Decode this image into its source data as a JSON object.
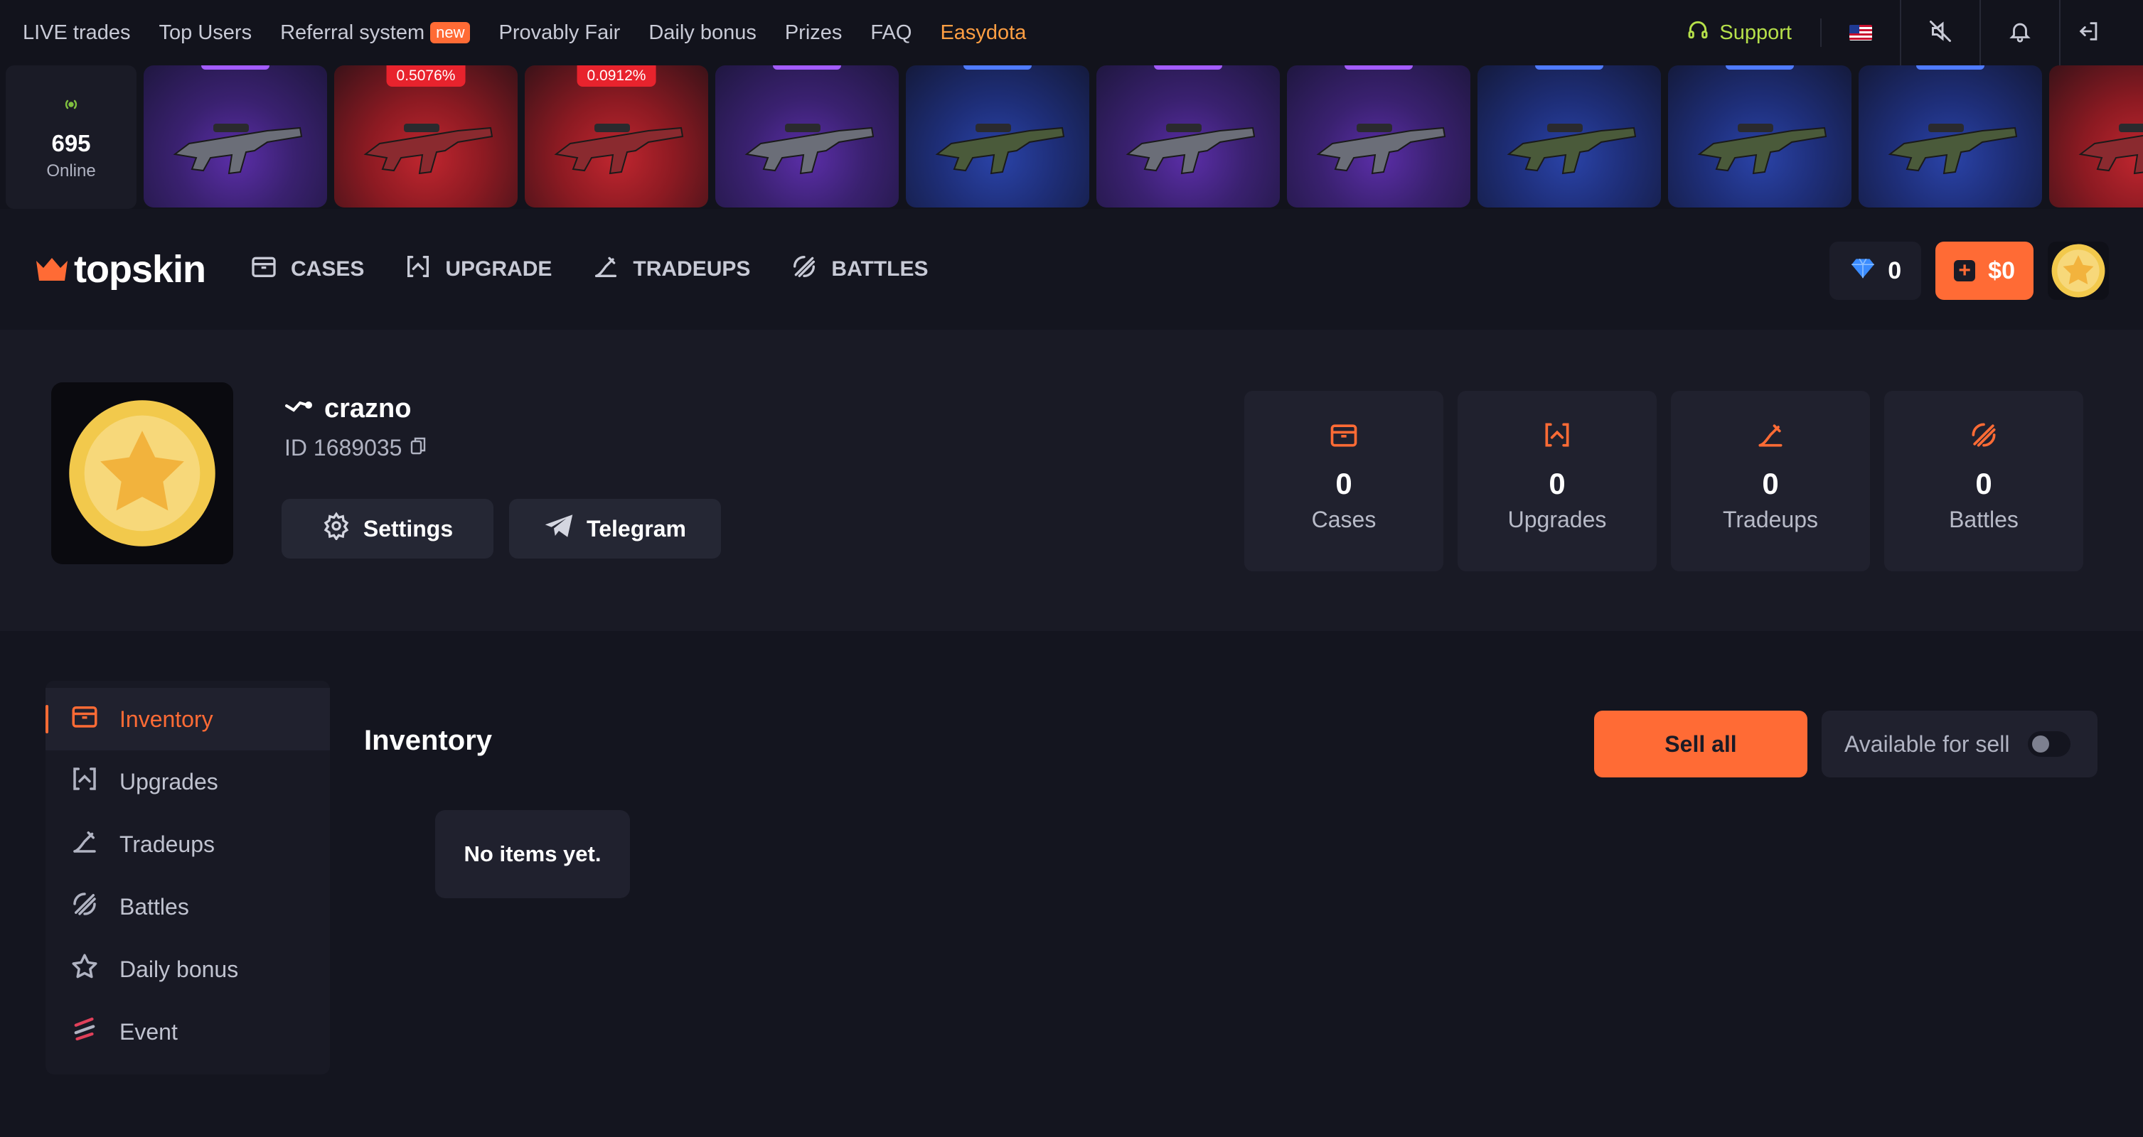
{
  "colors": {
    "accent": "#ff6b35",
    "support": "#b6e04a",
    "easydota": "#ff9f43",
    "background": "#14151f"
  },
  "topnav": {
    "items": [
      "LIVE trades",
      "Top Users",
      "Referral system",
      "Provably Fair",
      "Daily bonus",
      "Prizes",
      "FAQ",
      "Easydota"
    ],
    "new_badge": "new",
    "support": "Support"
  },
  "live": {
    "online_count": "695",
    "online_label": "Online",
    "drops": [
      {
        "rarity": "purple"
      },
      {
        "rarity": "red",
        "chance": "0.5076%"
      },
      {
        "rarity": "red",
        "chance": "0.0912%"
      },
      {
        "rarity": "purple"
      },
      {
        "rarity": "blue"
      },
      {
        "rarity": "purple"
      },
      {
        "rarity": "purple"
      },
      {
        "rarity": "blue"
      },
      {
        "rarity": "blue"
      },
      {
        "rarity": "blue"
      },
      {
        "rarity": "red"
      }
    ]
  },
  "header": {
    "logo": "topskin",
    "nav": [
      "CASES",
      "UPGRADE",
      "TRADEUPS",
      "BATTLES"
    ],
    "gems": "0",
    "balance": "$0"
  },
  "profile": {
    "username": "crazno",
    "id_label": "ID 1689035",
    "settings_button": "Settings",
    "telegram_button": "Telegram",
    "stats": [
      {
        "value": "0",
        "label": "Cases"
      },
      {
        "value": "0",
        "label": "Upgrades"
      },
      {
        "value": "0",
        "label": "Tradeups"
      },
      {
        "value": "0",
        "label": "Battles"
      }
    ]
  },
  "sidebar": {
    "items": [
      "Inventory",
      "Upgrades",
      "Tradeups",
      "Battles",
      "Daily bonus",
      "Event"
    ]
  },
  "inventory": {
    "title": "Inventory",
    "sell_all": "Sell all",
    "available_for_sell": "Available for sell",
    "empty_text": "No items yet."
  }
}
